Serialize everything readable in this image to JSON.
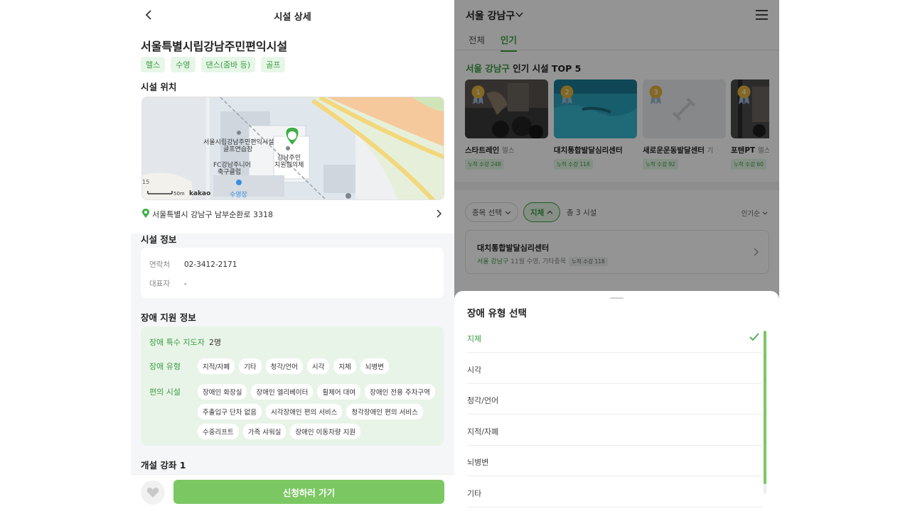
{
  "left": {
    "header_title": "시설 상세",
    "facility_name": "서울특별시립강남주민편익시설",
    "tags": [
      "헬스",
      "수영",
      "댄스(줌바 등)",
      "골프"
    ],
    "location_title": "시설 위치",
    "map": {
      "labels": {
        "place1": "서울시립강남주민편익시설",
        "place1b": "골프연습장",
        "place2": "강남주민",
        "place2b": "지원협의체",
        "place3": "FC강남주니어",
        "place3b": "축구클럽",
        "place4": "수영장",
        "scale": "50m",
        "brand": "kakao",
        "edge_num": "15"
      }
    },
    "address": "서울특별시 강남구 남부순환로 3318",
    "info_title": "시설 정보",
    "info": {
      "contact_label": "연락처",
      "contact_value": "02-3412-2171",
      "rep_label": "대표자",
      "rep_value": "-"
    },
    "disability_title": "장애 지원 정보",
    "disability": {
      "instructor_label": "장애 특수 지도자",
      "instructor_value": "2명",
      "type_label": "장애 유형",
      "types": [
        "지적/자폐",
        "기타",
        "청각/언어",
        "시각",
        "지체",
        "뇌병변"
      ],
      "facility_label": "편의 시설",
      "facilities": [
        "장애인 화장실",
        "장애인 엘리베이터",
        "휠체어 대여",
        "장애인 전용 주차구역",
        "주출입구 단차 없음",
        "시각장애인 편의 서비스",
        "청각장애인 편의 서비스",
        "수중리프트",
        "가족 샤워실",
        "장애인 이동차량 지원"
      ]
    },
    "courses_title": "개설 강좌 1",
    "apply_label": "신청하러 가기"
  },
  "right": {
    "region": "서울 강남구",
    "tabs": [
      "전체",
      "인기"
    ],
    "top5": {
      "region": "서울 강남구",
      "suffix": " 인기 시설 TOP 5"
    },
    "cards": [
      {
        "rank": "1",
        "name": "스타트레인",
        "category": "헬스",
        "count": "누적 수강 248"
      },
      {
        "rank": "2",
        "name": "대치통합발달심리센터",
        "category": "",
        "count": "누적 수강 118"
      },
      {
        "rank": "3",
        "name": "새로운운동발달센터",
        "category": "기",
        "count": "누적 수강 92"
      },
      {
        "rank": "4",
        "name": "포텐PT",
        "category": "헬스",
        "count": "누적 수강 60"
      }
    ],
    "filters": {
      "sport": "종목 선택",
      "type": "지체",
      "total": "총 3 시설",
      "sort": "인기순"
    },
    "list_item": {
      "name": "대치통합발달심리센터",
      "region": "서울 강남구",
      "detail": " 11월 수영, 기타종목",
      "badge": "누적 수강 118"
    },
    "sheet": {
      "title": "장애 유형 선택",
      "options": [
        "지체",
        "시각",
        "청각/언어",
        "지적/자폐",
        "뇌병변",
        "기타"
      ],
      "selected": "지체"
    }
  },
  "colors": {
    "accent": "#3b9d43",
    "button": "#7bc862",
    "tag_bg": "#e6f6e7",
    "card_bg": "#e9f4e8"
  }
}
